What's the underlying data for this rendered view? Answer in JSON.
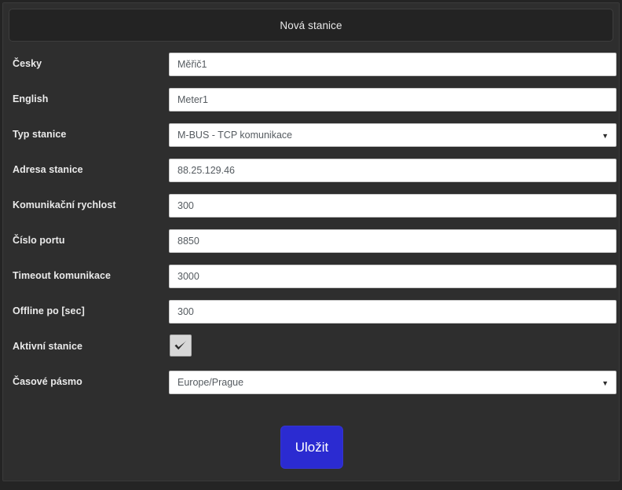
{
  "header": {
    "title": "Nová stanice"
  },
  "colors": {
    "page_background": "#242424",
    "panel_background": "#2e2e2e",
    "header_background": "#232323",
    "input_background": "#ffffff",
    "input_text": "#555b60",
    "label_text": "#eaeaea",
    "save_button": "#2b2bd1",
    "checkbox_background": "#d7d7d7"
  },
  "form": {
    "rows": [
      {
        "label": "Česky",
        "type": "text",
        "name": "station-name-cs",
        "value": "Měřič1",
        "placeholder": ""
      },
      {
        "label": "English",
        "type": "text",
        "name": "station-name-en",
        "value": "Meter1",
        "placeholder": ""
      },
      {
        "label": "Typ stanice",
        "type": "select",
        "name": "station-type",
        "value": "M-BUS - TCP komunikace",
        "caret": "▼"
      },
      {
        "label": "Adresa stanice",
        "type": "text",
        "name": "station-address",
        "value": "88.25.129.46",
        "placeholder": ""
      },
      {
        "label": "Komunikační rychlost",
        "type": "text",
        "name": "communication-speed",
        "value": "300",
        "placeholder": ""
      },
      {
        "label": "Číslo portu",
        "type": "text",
        "name": "port-number",
        "value": "8850",
        "placeholder": ""
      },
      {
        "label": "Timeout komunikace",
        "type": "text",
        "name": "communication-timeout",
        "value": "3000",
        "placeholder": ""
      },
      {
        "label": "Offline po [sec]",
        "type": "text",
        "name": "offline-after-sec",
        "value": "300",
        "placeholder": ""
      },
      {
        "label": "Aktivní stanice",
        "type": "checkbox",
        "name": "station-active",
        "checked": true,
        "icon": "checkmark-icon"
      },
      {
        "label": "Časové pásmo",
        "type": "select",
        "name": "timezone",
        "value": "Europe/Prague",
        "caret": "▼"
      }
    ]
  },
  "footer": {
    "save_label": "Uložit"
  }
}
